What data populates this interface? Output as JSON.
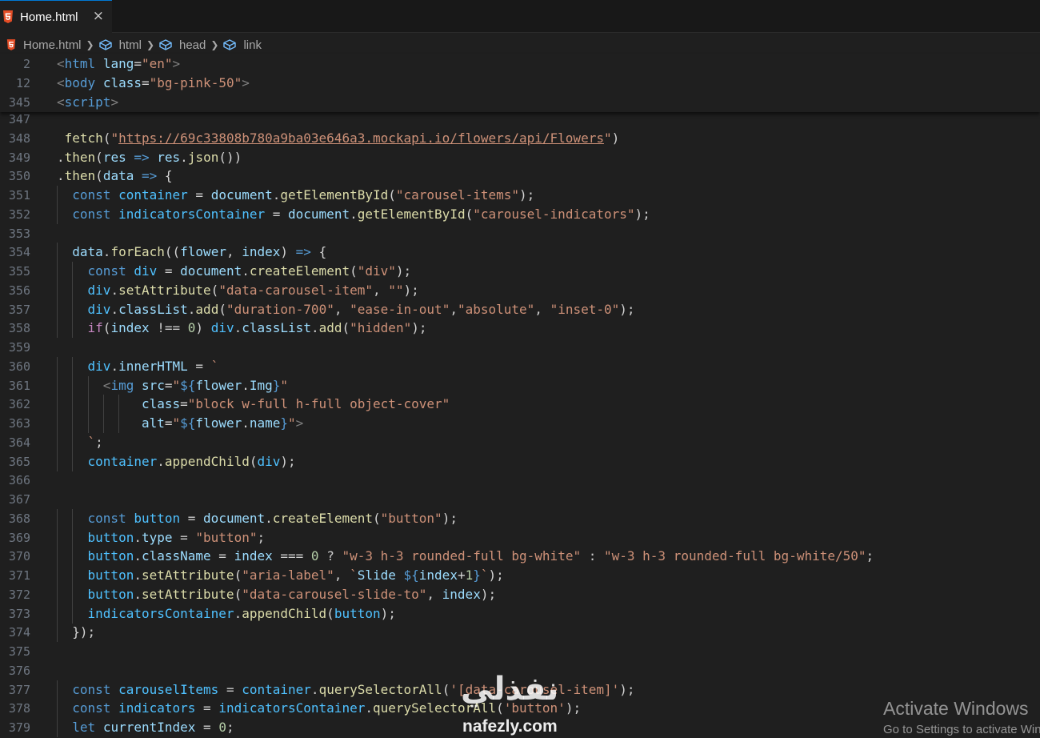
{
  "tab": {
    "label": "Home.html",
    "close_icon": "×"
  },
  "breadcrumb": [
    "Home.html",
    "html",
    "head",
    "link"
  ],
  "sticky_lines": [
    {
      "n": "2",
      "code": "<html lang=\"en\">"
    },
    {
      "n": "12",
      "code": "<body class=\"bg-pink-50\">"
    },
    {
      "n": "345",
      "code": "<script>"
    }
  ],
  "lines": [
    {
      "n": "347",
      "code": ""
    },
    {
      "n": "348",
      "code": " fetch(\"https://69c33808b780a9ba03e646a3.mockapi.io/flowers/api/Flowers\")"
    },
    {
      "n": "349",
      "code": ".then(res => res.json())"
    },
    {
      "n": "350",
      "code": ".then(data => {"
    },
    {
      "n": "351",
      "code": "  const container = document.getElementById(\"carousel-items\");"
    },
    {
      "n": "352",
      "code": "  const indicatorsContainer = document.getElementById(\"carousel-indicators\");"
    },
    {
      "n": "353",
      "code": ""
    },
    {
      "n": "354",
      "code": "  data.forEach((flower, index) => {"
    },
    {
      "n": "355",
      "code": "    const div = document.createElement(\"div\");"
    },
    {
      "n": "356",
      "code": "    div.setAttribute(\"data-carousel-item\", \"\");"
    },
    {
      "n": "357",
      "code": "    div.classList.add(\"duration-700\", \"ease-in-out\",\"absolute\", \"inset-0\");"
    },
    {
      "n": "358",
      "code": "    if(index !== 0) div.classList.add(\"hidden\");"
    },
    {
      "n": "359",
      "code": ""
    },
    {
      "n": "360",
      "code": "    div.innerHTML = `"
    },
    {
      "n": "361",
      "code": "      <img src=\"${flower.Img}\""
    },
    {
      "n": "362",
      "code": "           class=\"block w-full h-full object-cover\""
    },
    {
      "n": "363",
      "code": "           alt=\"${flower.name}\">"
    },
    {
      "n": "364",
      "code": "    `;"
    },
    {
      "n": "365",
      "code": "    container.appendChild(div);"
    },
    {
      "n": "366",
      "code": ""
    },
    {
      "n": "367",
      "code": ""
    },
    {
      "n": "368",
      "code": "    const button = document.createElement(\"button\");"
    },
    {
      "n": "369",
      "code": "    button.type = \"button\";"
    },
    {
      "n": "370",
      "code": "    button.className = index === 0 ? \"w-3 h-3 rounded-full bg-white\" : \"w-3 h-3 rounded-full bg-white/50\";"
    },
    {
      "n": "371",
      "code": "    button.setAttribute(\"aria-label\", `Slide ${index+1}`);"
    },
    {
      "n": "372",
      "code": "    button.setAttribute(\"data-carousel-slide-to\", index);"
    },
    {
      "n": "373",
      "code": "    indicatorsContainer.appendChild(button);"
    },
    {
      "n": "374",
      "code": "  });"
    },
    {
      "n": "375",
      "code": ""
    },
    {
      "n": "376",
      "code": ""
    },
    {
      "n": "377",
      "code": "  const carouselItems = container.querySelectorAll('[data-carousel-item]');"
    },
    {
      "n": "378",
      "code": "  const indicators = indicatorsContainer.querySelectorAll('button');"
    },
    {
      "n": "379",
      "code": "  let currentIndex = 0;"
    }
  ],
  "watermark": {
    "arabic": "نفذلي",
    "latin": "nafezly.com"
  },
  "activation": {
    "title": "Activate Windows",
    "subtitle": "Go to Settings to activate Windows."
  },
  "colors": {
    "editor_bg": "#1f1f1f",
    "tab_accent": "#0078d4",
    "html_icon": "#e44d26"
  },
  "icons": {
    "tab": "html5-icon",
    "breadcrumb_file": "html5-icon",
    "breadcrumb_element": "element-cube-icon",
    "separator": "chevron-right-icon"
  }
}
